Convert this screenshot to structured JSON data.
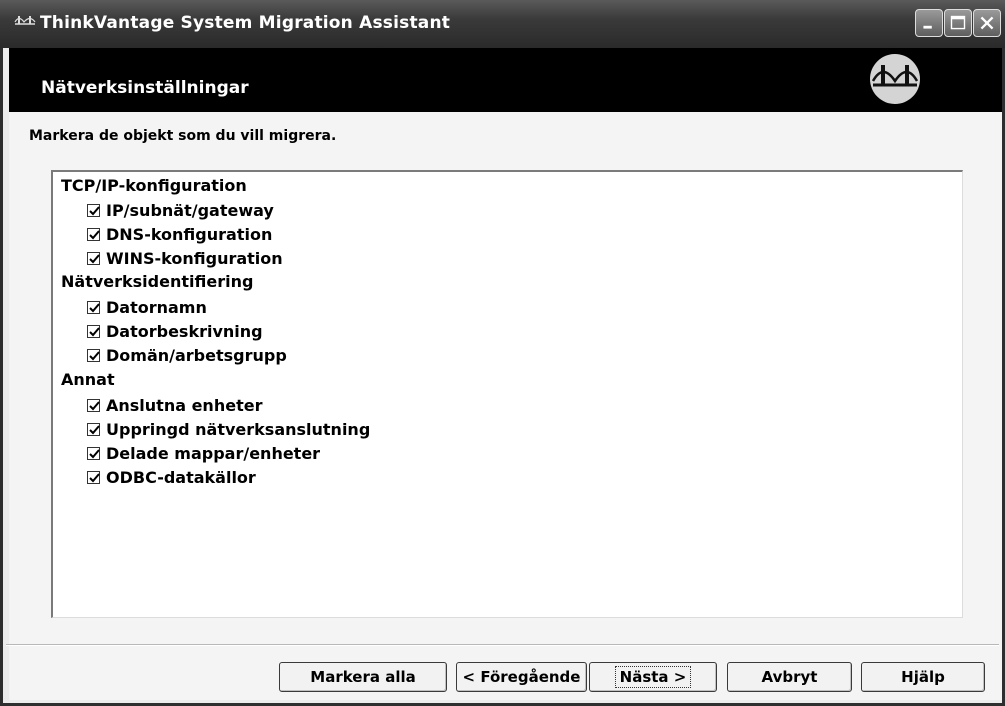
{
  "window": {
    "title": "ThinkVantage System Migration Assistant"
  },
  "header": {
    "title": "Nätverksinställningar"
  },
  "instruction": "Markera de objekt som du vill migrera.",
  "groups": [
    {
      "label": "TCP/IP-konfiguration",
      "items": [
        {
          "label": "IP/subnät/gateway",
          "checked": true
        },
        {
          "label": "DNS-konfiguration",
          "checked": true
        },
        {
          "label": "WINS-konfiguration",
          "checked": true
        }
      ]
    },
    {
      "label": "Nätverksidentifiering",
      "items": [
        {
          "label": "Datornamn",
          "checked": true
        },
        {
          "label": "Datorbeskrivning",
          "checked": true
        },
        {
          "label": "Domän/arbetsgrupp",
          "checked": true
        }
      ]
    },
    {
      "label": "Annat",
      "items": [
        {
          "label": "Anslutna enheter",
          "checked": true
        },
        {
          "label": "Uppringd nätverksanslutning",
          "checked": true
        },
        {
          "label": "Delade mappar/enheter",
          "checked": true
        },
        {
          "label": "ODBC-datakällor",
          "checked": true
        }
      ]
    }
  ],
  "buttons": {
    "select_all": "Markera alla",
    "previous": "< Föregående",
    "next": "Nästa >",
    "cancel": "Avbryt",
    "help": "Hjälp"
  }
}
